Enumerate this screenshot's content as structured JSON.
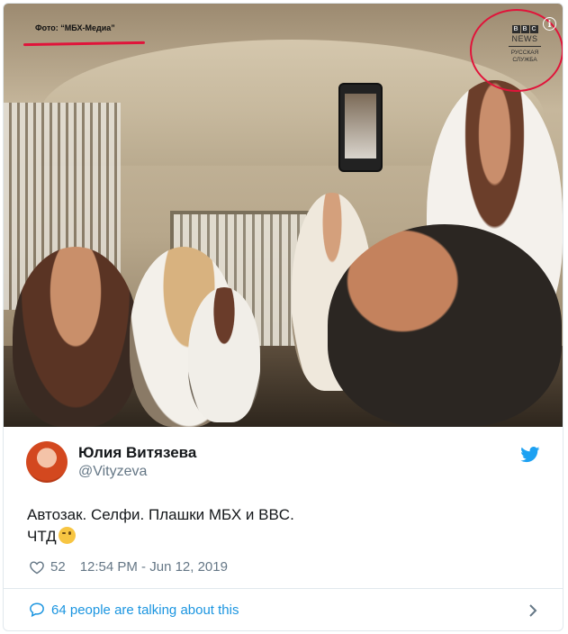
{
  "photo": {
    "credit": "Фото: “МБХ-Медиа”",
    "bbc_letters": [
      "B",
      "B",
      "C"
    ],
    "bbc_news": "NEWS",
    "bbc_service_line1": "РУССКАЯ",
    "bbc_service_line2": "СЛУЖБА",
    "info_glyph": "i",
    "accent_color": "#e0143a"
  },
  "author": {
    "name": "Юлия Витязева",
    "handle": "@Vityzeva"
  },
  "tweet": {
    "line1": "Автозак. Селфи. Плашки МБХ и BBC.",
    "line2": "ЧТД",
    "emoji": "winking-face"
  },
  "meta": {
    "likes": "52",
    "timestamp": "12:54 PM - Jun 12, 2019"
  },
  "footer": {
    "talking": "64 people are talking about this"
  },
  "colors": {
    "twitter_blue": "#1da1f2",
    "link_blue": "#1b95e0",
    "muted": "#657786"
  }
}
